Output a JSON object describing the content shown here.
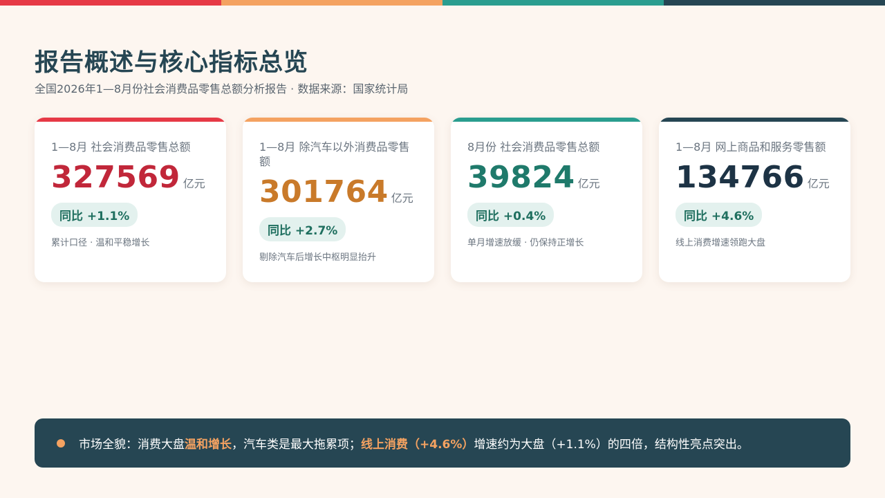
{
  "colors": {
    "red": "#e63946",
    "orange": "#f4a261",
    "teal": "#2a9d8f",
    "navy": "#264653",
    "value_red": "#c1273a",
    "value_orange": "#c97a2a",
    "value_teal": "#1f7a6b",
    "value_navy": "#1d3345"
  },
  "header": {
    "title": "报告概述与核心指标总览",
    "subtitle": "全国2026年1—8月份社会消费品零售总额分析报告 · 数据来源：国家统计局"
  },
  "cards": [
    {
      "label": "1—8月 社会消费品零售总额",
      "value": "327569",
      "unit": "亿元",
      "badge": "同比 +1.1%",
      "note": "累计口径 · 温和平稳增长"
    },
    {
      "label": "1—8月 除汽车以外消费品零售额",
      "value": "301764",
      "unit": "亿元",
      "badge": "同比 +2.7%",
      "note": "剔除汽车后增长中枢明显抬升"
    },
    {
      "label": "8月份 社会消费品零售总额",
      "value": "39824",
      "unit": "亿元",
      "badge": "同比 +0.4%",
      "note": "单月增速放缓 · 仍保持正增长"
    },
    {
      "label": "1—8月 网上商品和服务零售额",
      "value": "134766",
      "unit": "亿元",
      "badge": "同比 +4.6%",
      "note": "线上消费增速领跑大盘"
    }
  ],
  "summary": {
    "part1": "市场全貌：消费大盘",
    "highlight1": "温和增长",
    "part2": "，汽车类是最大拖累项；",
    "highlight2": "线上消费（+4.6%）",
    "part3": "增速约为大盘（+1.1%）的四倍，结构性亮点突出。"
  }
}
